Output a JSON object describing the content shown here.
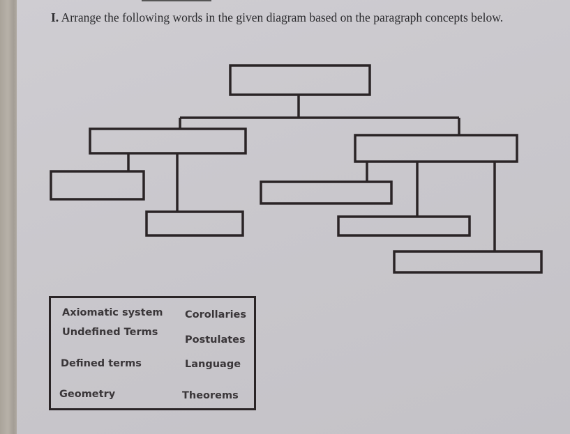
{
  "instruction": {
    "number": "I.",
    "text": "Arrange the following words in the given diagram based on the paragraph concepts below."
  },
  "diagram": {
    "nodes": [
      {
        "id": "root",
        "label": ""
      },
      {
        "id": "left-mid",
        "label": ""
      },
      {
        "id": "right-mid",
        "label": ""
      },
      {
        "id": "left-child-1",
        "label": ""
      },
      {
        "id": "left-child-2",
        "label": ""
      },
      {
        "id": "right-child-1",
        "label": ""
      },
      {
        "id": "right-child-2",
        "label": ""
      },
      {
        "id": "right-child-3",
        "label": ""
      }
    ]
  },
  "word_bank": {
    "words": [
      "Axiomatic system",
      "Corollaries",
      "Undefined Terms",
      "Postulates",
      "Defined terms",
      "Language",
      "Geometry",
      "Theorems"
    ]
  },
  "colors": {
    "ink": "#2a2426",
    "paper": "#cbc9ce"
  }
}
